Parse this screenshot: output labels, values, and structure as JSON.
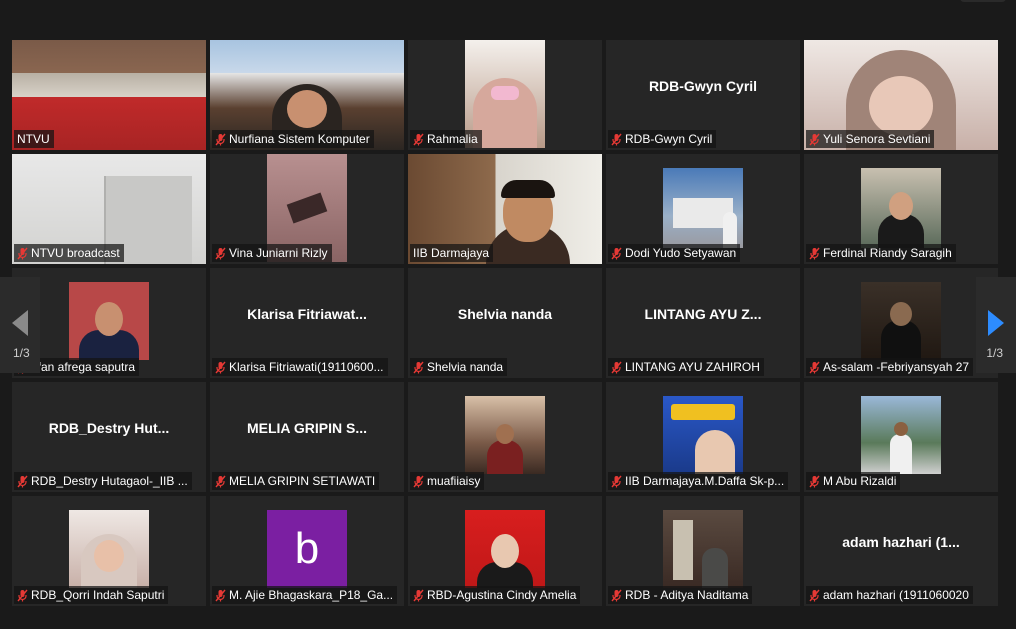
{
  "paging": {
    "current": "1/3"
  },
  "colors": {
    "active_speaker": "#e4ec8a",
    "muted_mic": "#e53935",
    "nav_arrow_right": "#2d8cff"
  },
  "tiles": [
    {
      "display": "",
      "label": "NTVU"
    },
    {
      "display": "",
      "label": "Nurfiana Sistem Komputer",
      "muted": true
    },
    {
      "display": "",
      "label": "Rahmalia",
      "muted": true
    },
    {
      "display": "RDB-Gwyn Cyril",
      "label": "RDB-Gwyn Cyril",
      "muted": true
    },
    {
      "display": "",
      "label": "Yuli Senora Sevtiani",
      "muted": true
    },
    {
      "display": "",
      "label": "NTVU broadcast",
      "muted": true
    },
    {
      "display": "",
      "label": "Vina Juniarni Rizly",
      "muted": true
    },
    {
      "display": "",
      "label": "IIB Darmajaya"
    },
    {
      "display": "",
      "label": "Dodi Yudo Setyawan",
      "muted": true
    },
    {
      "display": "",
      "label": "Ferdinal Riandy Saragih",
      "muted": true
    },
    {
      "display": "",
      "label": "irfan afrega saputra",
      "muted": true
    },
    {
      "display": "Klarisa  Fitriawat...",
      "label": "Klarisa Fitriawati(19110600...",
      "muted": true
    },
    {
      "display": "Shelvia nanda",
      "label": "Shelvia nanda",
      "muted": true
    },
    {
      "display": "LINTANG AYU Z...",
      "label": "LINTANG AYU ZAHIROH",
      "muted": true
    },
    {
      "display": "",
      "label": "As-salam -Febriyansyah 27",
      "muted": true
    },
    {
      "display": "RDB_Destry  Hut...",
      "label": "RDB_Destry Hutagaol-_IIB ...",
      "muted": true
    },
    {
      "display": "MELIA GRIPIN S...",
      "label": "MELIA GRIPIN SETIAWATI",
      "muted": true
    },
    {
      "display": "",
      "label": "muafiiaisy",
      "muted": true
    },
    {
      "display": "",
      "label": "IIB Darmajaya.M.Daffa Sk-p...",
      "muted": true
    },
    {
      "display": "",
      "label": "M Abu Rizaldi",
      "muted": true
    },
    {
      "display": "",
      "label": "RDB_Qorri Indah Saputri",
      "muted": true
    },
    {
      "display": "b",
      "label": "M. Ajie Bhagaskara_P18_Ga...",
      "muted": true
    },
    {
      "display": "",
      "label": "RBD-Agustina Cindy Amelia",
      "muted": true
    },
    {
      "display": "",
      "label": "RDB - Aditya Naditama",
      "muted": true
    },
    {
      "display": "adam  hazhari (1...",
      "label": "adam hazhari (1911060020",
      "muted": true
    }
  ]
}
